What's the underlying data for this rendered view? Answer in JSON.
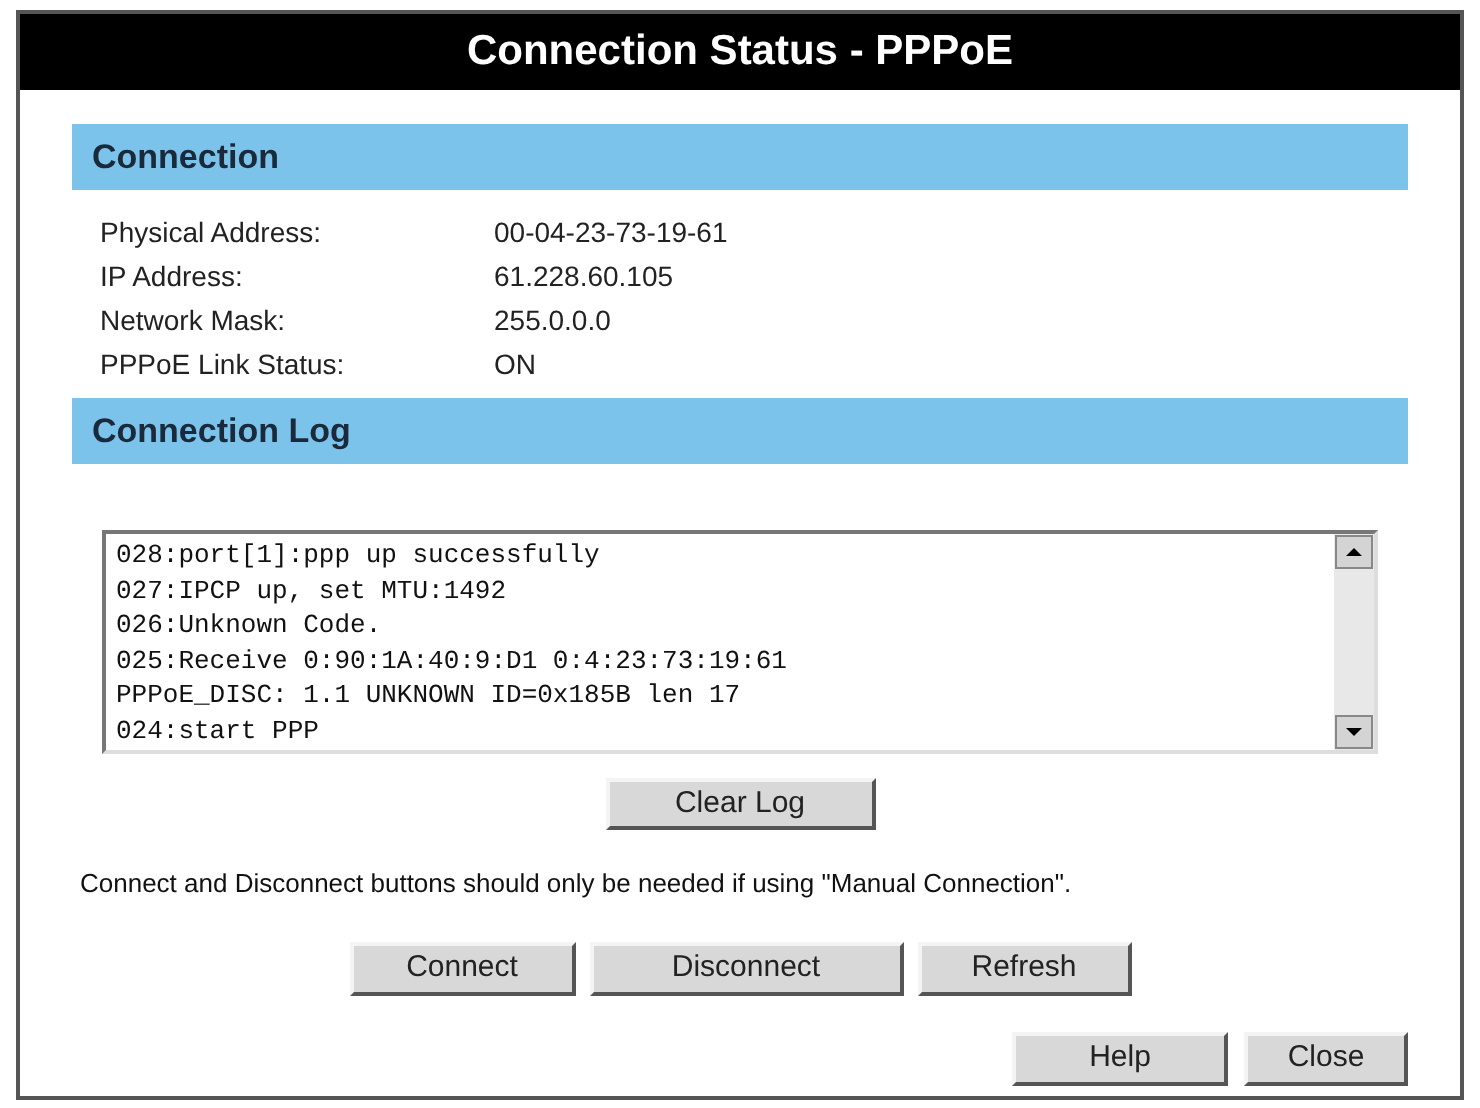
{
  "window": {
    "title": "Connection Status - PPPoE"
  },
  "connection": {
    "heading": "Connection",
    "fields": [
      {
        "label": "Physical Address:",
        "value": "00-04-23-73-19-61"
      },
      {
        "label": "IP Address:",
        "value": "61.228.60.105"
      },
      {
        "label": "Network Mask:",
        "value": "255.0.0.0"
      },
      {
        "label": "PPPoE Link Status:",
        "value": "ON"
      }
    ]
  },
  "log": {
    "heading": "Connection Log",
    "lines": [
      "028:port[1]:ppp up successfully",
      "027:IPCP up, set MTU:1492",
      "026:Unknown Code.",
      "025:Receive 0:90:1A:40:9:D1 0:4:23:73:19:61",
      "PPPoE_DISC: 1.1 UNKNOWN ID=0x185B len 17",
      "024:start PPP"
    ],
    "button": "Clear Log"
  },
  "note": "Connect and Disconnect buttons should only be needed if using \"Manual Connection\".",
  "action_buttons": [
    "Connect",
    "Disconnect",
    "Refresh"
  ],
  "footer_buttons": [
    "Help",
    "Close"
  ]
}
